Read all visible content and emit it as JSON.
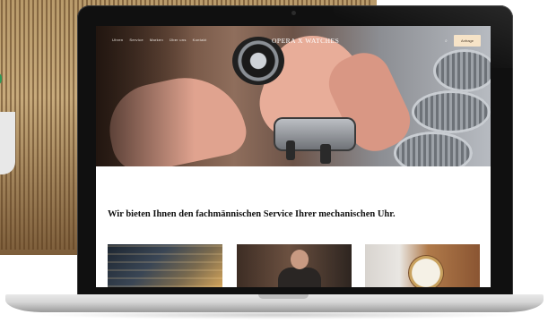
{
  "site": {
    "logo_text": "OPERA X WATCHES",
    "nav_items": [
      "Uhren",
      "Service",
      "Marken",
      "Über uns",
      "Kontakt"
    ],
    "cta_label": "Anfrage",
    "headline": "Wir bieten Ihnen den fachmännischen Service Ihrer mechanischen Uhr."
  },
  "colors": {
    "cta_background": "#f6e3c7",
    "laptop_frame": "#101010",
    "page_background": "#ffffff"
  },
  "icons": {
    "header_icon": "search-icon"
  }
}
